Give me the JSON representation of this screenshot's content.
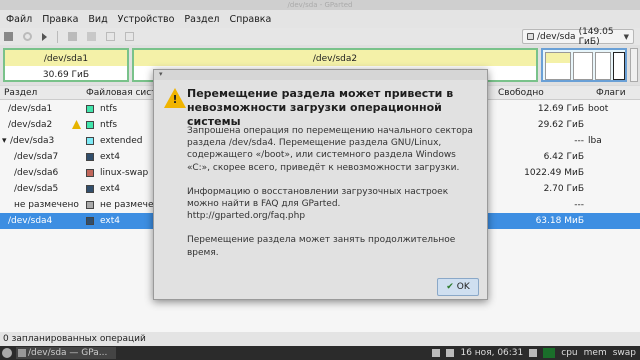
{
  "window": {
    "title": "/dev/sda - GParted"
  },
  "menu": [
    "Файл",
    "Правка",
    "Вид",
    "Устройство",
    "Раздел",
    "Справка"
  ],
  "toolbar": {
    "device": "/dev/sda",
    "device_size": "(149.05 ГиБ)"
  },
  "partition_map": [
    {
      "name": "/dev/sda1",
      "size": "30.69 ГиБ"
    },
    {
      "name": "/dev/sda2",
      "size": ""
    }
  ],
  "table": {
    "headers": {
      "partition": "Раздел",
      "fs": "Файловая сист",
      "free": "Свободно",
      "flags": "Флаги"
    },
    "rows": [
      {
        "part": "/dev/sda1",
        "fs": "ntfs",
        "free": "12.69 ГиБ",
        "flags": "boot",
        "color": "#42e5ac",
        "indent": 0,
        "tree": "",
        "warn": false
      },
      {
        "part": "/dev/sda2",
        "fs": "ntfs",
        "free": "29.62 ГиБ",
        "flags": "",
        "color": "#42e5ac",
        "indent": 0,
        "tree": "",
        "warn": true
      },
      {
        "part": "/dev/sda3",
        "fs": "extended",
        "free": "---",
        "flags": "lba",
        "color": "#7eeaf6",
        "indent": 0,
        "tree": "▾",
        "warn": false
      },
      {
        "part": "/dev/sda7",
        "fs": "ext4",
        "free": "6.42 ГиБ",
        "flags": "",
        "color": "#314e6c",
        "indent": 1,
        "tree": "",
        "warn": false
      },
      {
        "part": "/dev/sda6",
        "fs": "linux-swap",
        "free": "1022.49 МиБ",
        "flags": "",
        "color": "#c1665a",
        "indent": 1,
        "tree": "",
        "warn": false
      },
      {
        "part": "/dev/sda5",
        "fs": "ext4",
        "free": "2.70 ГиБ",
        "flags": "",
        "color": "#314e6c",
        "indent": 1,
        "tree": "",
        "warn": false
      },
      {
        "part": "не размечено",
        "fs": "не размечено",
        "free": "---",
        "flags": "",
        "color": "#a9a9a9",
        "indent": 1,
        "tree": "",
        "warn": false
      },
      {
        "part": "/dev/sda4",
        "fs": "ext4",
        "free": "63.18 МиБ",
        "flags": "",
        "color": "#314e6c",
        "indent": 0,
        "tree": "",
        "warn": false,
        "selected": true
      }
    ]
  },
  "status": "0 запланированных операций",
  "panel": {
    "task": "/dev/sda — GPa...",
    "clock": "16 ноя, 06:31",
    "cpu": "cpu",
    "mem": "mem",
    "swap": "swap"
  },
  "dialog": {
    "title": "Перемещение раздела может привести в невозможности загрузки операционной системы",
    "paragraph1": "Запрошена операция по перемещению начального сектора раздела /dev/sda4.  Перемещение раздела GNU/Linux, содержащего «/boot», или системного раздела Windows «C:», скорее всего, приведёт к невозможности загрузки.",
    "paragraph2": "Информацию о восстановлении загрузочных настроек можно найти в FAQ для GParted.",
    "paragraph3": "http://gparted.org/faq.php",
    "paragraph4": "Перемещение раздела может занять продолжительное время.",
    "ok_label": "OK"
  }
}
